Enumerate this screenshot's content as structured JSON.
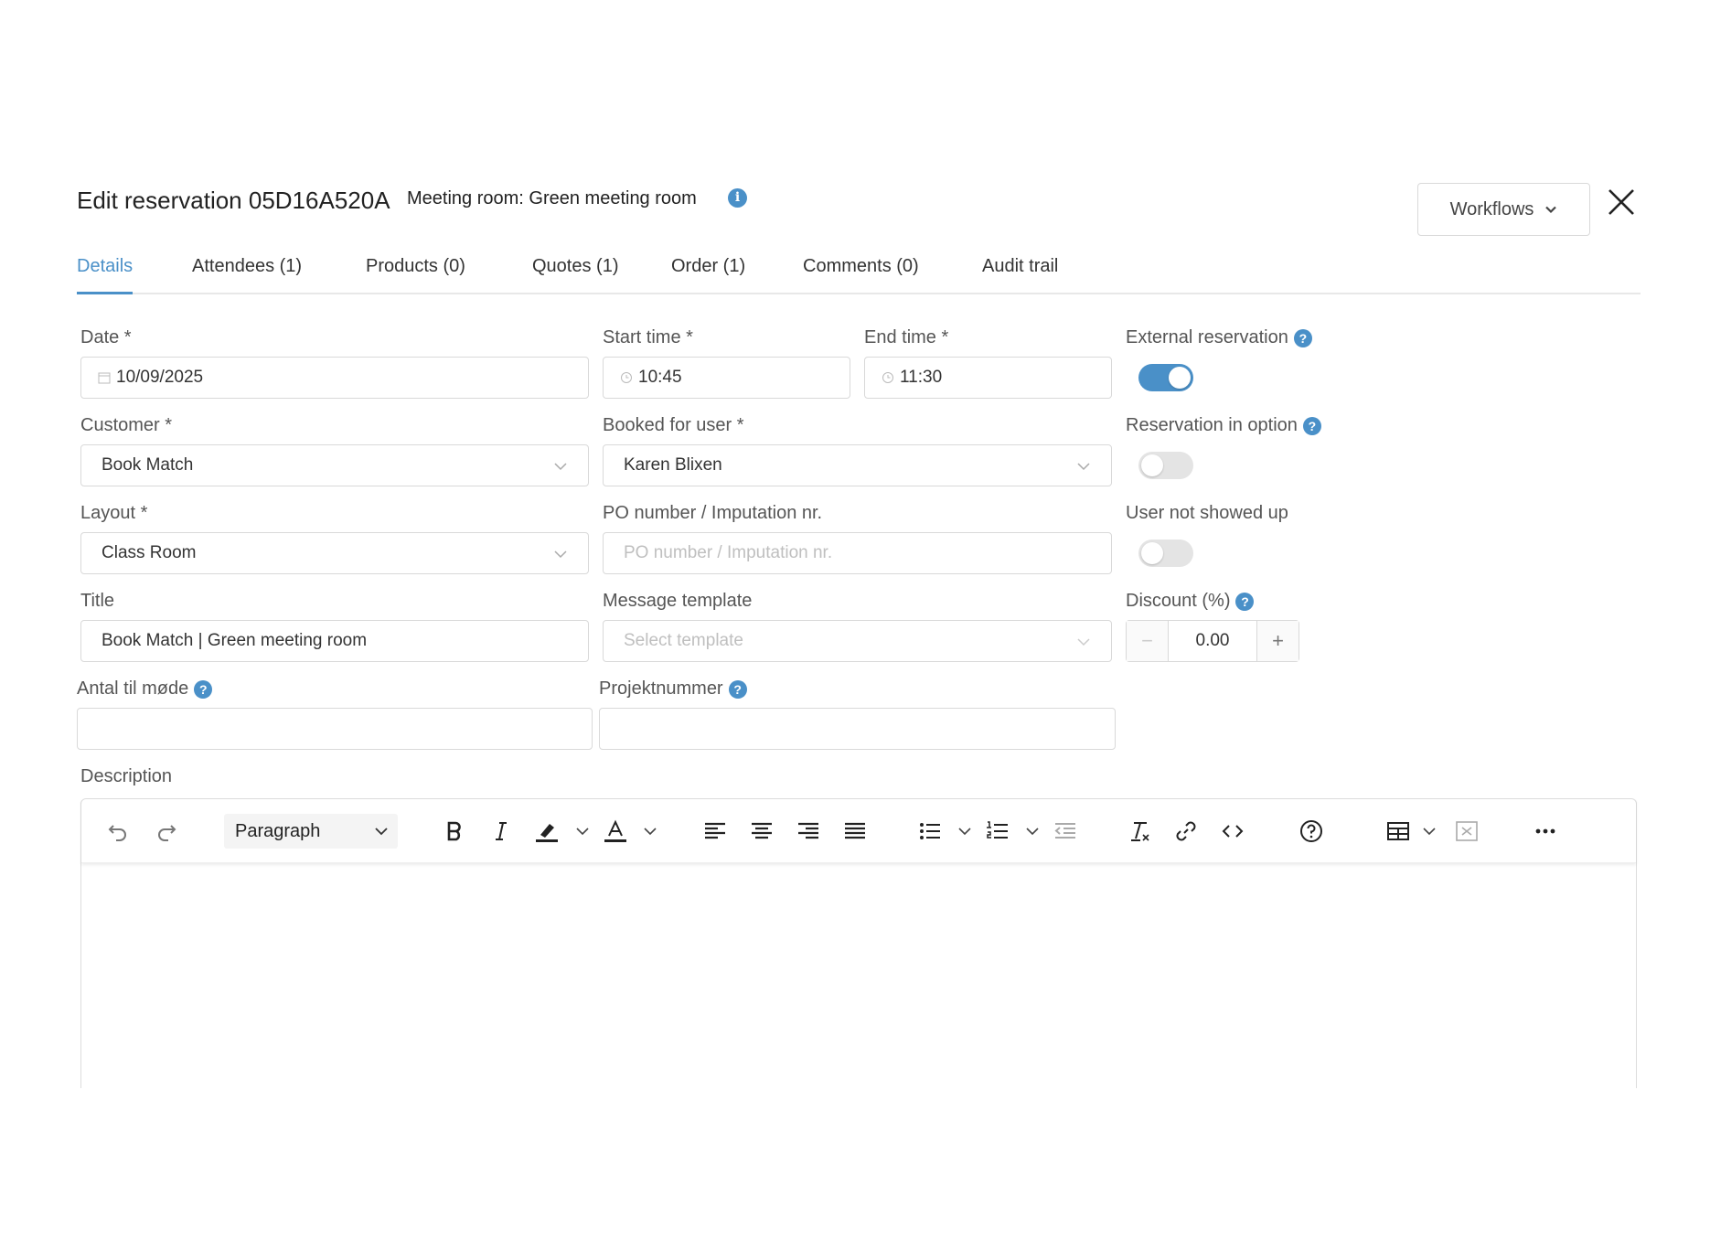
{
  "header": {
    "title": "Edit reservation 05D16A520A",
    "subtitle": "Meeting room: Green meeting room",
    "info_icon": "info-icon",
    "workflows_label": "Workflows",
    "close_icon": "close-icon"
  },
  "tabs": [
    {
      "label": "Details",
      "active": true
    },
    {
      "label": "Attendees (1)",
      "active": false
    },
    {
      "label": "Products (0)",
      "active": false
    },
    {
      "label": "Quotes (1)",
      "active": false
    },
    {
      "label": "Order (1)",
      "active": false
    },
    {
      "label": "Comments (0)",
      "active": false
    },
    {
      "label": "Audit trail",
      "active": false
    }
  ],
  "form": {
    "date": {
      "label": "Date *",
      "value": "10/09/2025"
    },
    "start_time": {
      "label": "Start time *",
      "value": "10:45"
    },
    "end_time": {
      "label": "End time *",
      "value": "11:30"
    },
    "external_reservation": {
      "label": "External reservation",
      "on": true
    },
    "customer": {
      "label": "Customer *",
      "value": "Book Match"
    },
    "booked_for_user": {
      "label": "Booked for user *",
      "value": "Karen Blixen"
    },
    "reservation_in_option": {
      "label": "Reservation in option",
      "on": false
    },
    "layout": {
      "label": "Layout *",
      "value": "Class Room"
    },
    "po_number": {
      "label": "PO number / Imputation nr.",
      "value": "",
      "placeholder": "PO number / Imputation nr."
    },
    "user_not_showed_up": {
      "label": "User not showed up",
      "on": false
    },
    "title": {
      "label": "Title",
      "value": "Book Match | Green meeting room"
    },
    "message_template": {
      "label": "Message template",
      "value": "",
      "placeholder": "Select template"
    },
    "discount": {
      "label": "Discount (%)",
      "value": "0.00",
      "minus": "−",
      "plus": "+"
    },
    "antal_til_mode": {
      "label": "Antal til møde",
      "value": ""
    },
    "projektnummer": {
      "label": "Projektnummer",
      "value": ""
    },
    "description": {
      "label": "Description",
      "block_format": "Paragraph"
    }
  },
  "help_glyph": "?",
  "info_glyph": "i",
  "colors": {
    "accent": "#4a90c8",
    "border": "#d9d9d9",
    "placeholder": "#bfbfbf"
  }
}
